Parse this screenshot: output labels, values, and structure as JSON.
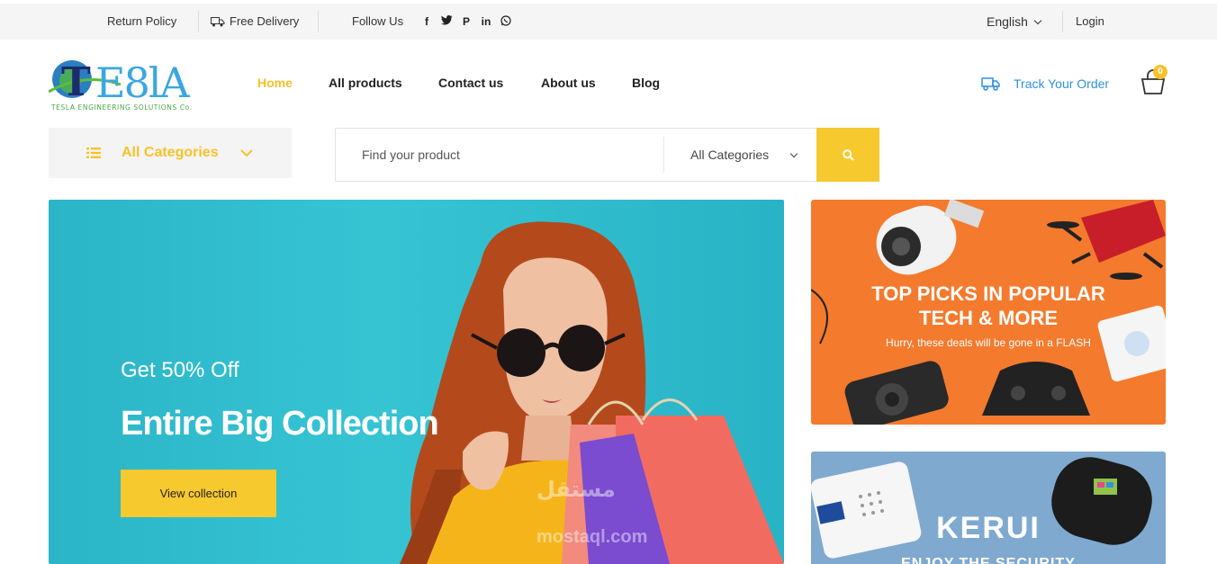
{
  "topbar": {
    "return_policy": "Return Policy",
    "free_delivery": "Free Delivery",
    "follow_us": "Follow Us",
    "social_icons": [
      "facebook-icon",
      "twitter-icon",
      "pinterest-icon",
      "linkedin-icon",
      "whatsapp-icon"
    ],
    "language": "English",
    "login": "Login"
  },
  "header": {
    "logo_text": "TE8lA",
    "logo_tagline": "TESLA ENGINEERING SOLUTIONS Co.",
    "nav": [
      {
        "label": "Home",
        "active": true
      },
      {
        "label": "All products",
        "active": false
      },
      {
        "label": "Contact us",
        "active": false
      },
      {
        "label": "About us",
        "active": false
      },
      {
        "label": "Blog",
        "active": false
      }
    ],
    "track_order": "Track Your Order",
    "cart_count": "0"
  },
  "search": {
    "categories_label": "All Categories",
    "placeholder": "Find your product",
    "select_value": "All Categories"
  },
  "hero": {
    "subtitle": "Get 50% Off",
    "title": "Entire Big Collection",
    "cta": "View collection"
  },
  "banner_top": {
    "line1": "TOP PICKS IN POPULAR",
    "line2": "TECH & MORE",
    "subtext": "Hurry, these deals will be gone in a FLASH"
  },
  "banner_bottom": {
    "brand": "KERUI",
    "tagline": "ENJOY THE SECURITY"
  },
  "watermark": {
    "arabic": "مستقل",
    "latin": "mostaql.com"
  },
  "colors": {
    "accent": "#f6c22a",
    "link_blue": "#2f8fe0",
    "hero_bg": "#36c4d3",
    "banner_orange": "#f47a2d",
    "banner_blue": "#7fa9cf"
  }
}
